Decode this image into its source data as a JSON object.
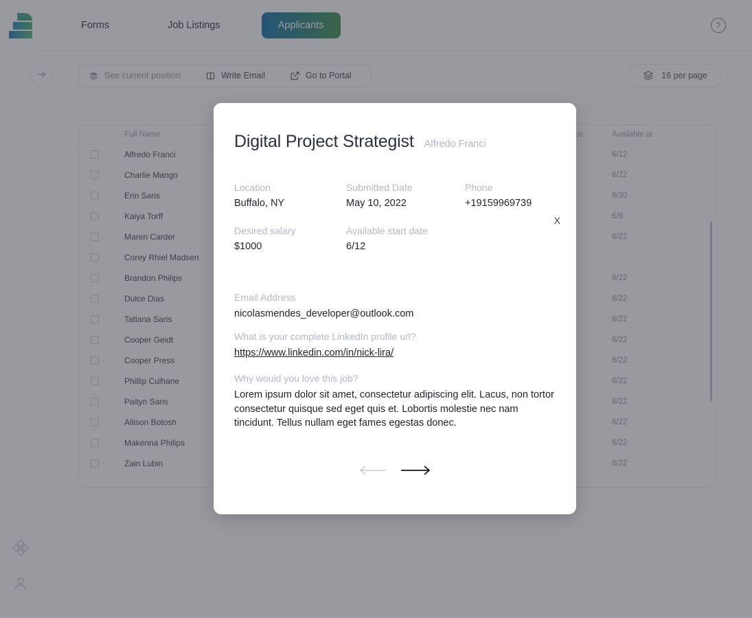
{
  "brand": {
    "logo_name": "app-logo",
    "gradient_from": "#1379c9",
    "gradient_to": "#56b46a"
  },
  "sidebar": {
    "collapse_label": "→",
    "items": [
      {
        "icon": "apps-diamond-icon"
      },
      {
        "icon": "user-icon"
      }
    ]
  },
  "topbar": {
    "tabs": [
      {
        "label": "Forms",
        "active": false
      },
      {
        "label": "Job Listings",
        "active": false
      },
      {
        "label": "Applicants",
        "active": true
      }
    ],
    "help_label": "?"
  },
  "toolbar": {
    "actions": [
      {
        "label": "See current position",
        "icon": "layers-icon",
        "muted": true
      },
      {
        "label": "Write Email",
        "icon": "book-icon",
        "muted": false
      },
      {
        "label": "Go to Portal",
        "icon": "external-link-icon",
        "muted": false
      }
    ],
    "per_page": {
      "label": "16 per page",
      "icon": "layers-icon"
    }
  },
  "table": {
    "columns": [
      "Full Name",
      "ence",
      "Available at"
    ],
    "rows": [
      {
        "name": "Alfredo Franci",
        "available_at": "6/12"
      },
      {
        "name": "Charlie Mango",
        "available_at": "6/22"
      },
      {
        "name": "Erin Saris",
        "available_at": "6/30"
      },
      {
        "name": "Kaiya Torff",
        "available_at": "6/8"
      },
      {
        "name": "Maren Carder",
        "available_at": "6/22"
      },
      {
        "name": "Corey Rhiel Madsen",
        "available_at": ""
      },
      {
        "name": "Brandon Philips",
        "available_at": "6/22"
      },
      {
        "name": "Dulce Dias",
        "available_at": "6/22"
      },
      {
        "name": "Tatiana Saris",
        "available_at": "6/22"
      },
      {
        "name": "Cooper Geidt",
        "available_at": "6/22"
      },
      {
        "name": "Cooper Press",
        "available_at": "6/22"
      },
      {
        "name": "Phillip Culhane",
        "available_at": "6/22"
      },
      {
        "name": "Paityn Saris",
        "available_at": "6/22"
      },
      {
        "name": "Allison Botosh",
        "available_at": "6/22"
      },
      {
        "name": "Makenna Philips",
        "available_at": "6/22"
      },
      {
        "name": "Zain Lubin",
        "available_at": "6/22"
      }
    ]
  },
  "modal": {
    "close_label": "X",
    "title": "Digital Project Strategist",
    "applicant": "Alfredo Franci",
    "fields_row1": [
      {
        "label": "Location",
        "value": "Buffalo, NY"
      },
      {
        "label": "Submitted Date",
        "value": "May 10, 2022"
      },
      {
        "label": "Phone",
        "value": "+19159969739"
      }
    ],
    "fields_row2": [
      {
        "label": "Desired salary",
        "value": "$1000"
      },
      {
        "label": "Available start date",
        "value": "6/12"
      }
    ],
    "questions": [
      {
        "label": "Email Address",
        "value": "nicolasmendes_developer@outlook.com",
        "is_link": false
      },
      {
        "label": "What is your complete LinkedIn profile url?",
        "value": "https://www.linkedin.com/in/nick-lira/",
        "is_link": true
      },
      {
        "label": "Why would you love this job?",
        "value": "Lorem ipsum dolor sit amet, consectetur adipiscing elit. Lacus, non tortor consectetur quisque sed eget quis et. Lobortis molestie nec nam tincidunt. Tellus nullam eget fames egestas donec.",
        "is_link": false
      }
    ],
    "nav": {
      "prev": "←",
      "next": "→"
    }
  }
}
